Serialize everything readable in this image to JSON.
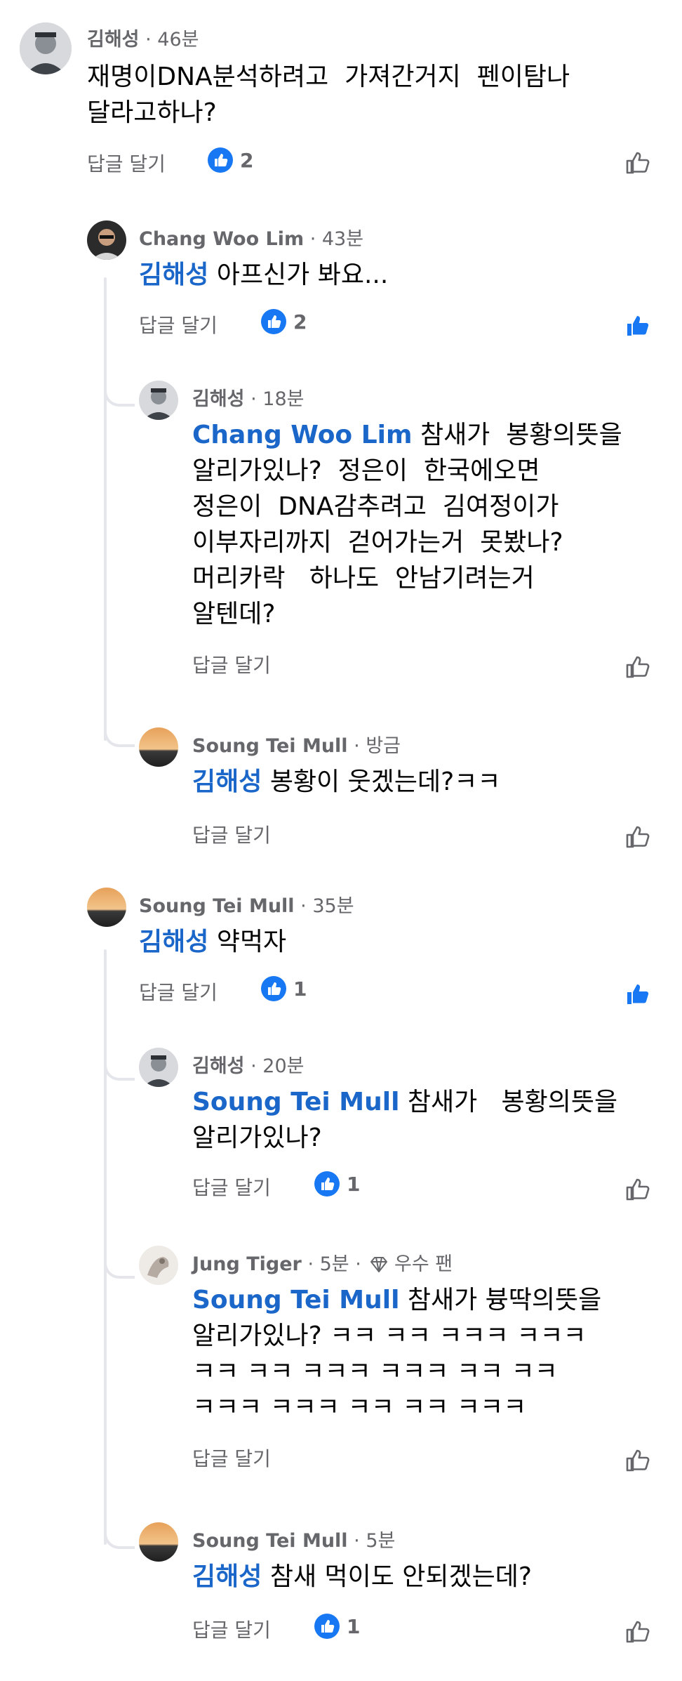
{
  "comments": [
    {
      "author": "김해성",
      "time": "· 46분",
      "text": "재명이DNA분석하려고  가져간거지  펜이탐나\n달라고하나?",
      "reply": "답글 달기",
      "likes": "2"
    },
    {
      "author": "Chang Woo Lim",
      "time": "· 43분",
      "mention": "김해성",
      "text": " 아프신가 봐요...",
      "reply": "답글 달기",
      "likes": "2"
    },
    {
      "author": "김해성",
      "time": "· 18분",
      "mention": "Chang Woo Lim",
      "text": " 참새가  봉황의뜻을\n알리가있나?  정은이  한국에오면\n정은이  DNA감추려고  김여정이가\n이부자리까지  걷어가는거  못봤나?\n머리카락   하나도  안남기려는거\n알텐데?",
      "reply": "답글 달기"
    },
    {
      "author": "Soung Tei Mull",
      "time": "· 방금",
      "mention": "김해성",
      "text": " 봉황이 웃겠는데?ㅋㅋ",
      "reply": "답글 달기"
    },
    {
      "author": "Soung Tei Mull",
      "time": "· 35분",
      "mention": "김해성",
      "text": " 약먹자",
      "reply": "답글 달기",
      "likes": "1"
    },
    {
      "author": "김해성",
      "time": "· 20분",
      "mention": "Soung Tei Mull",
      "text": " 참새가   봉황의뜻을\n알리가있나?",
      "reply": "답글 달기",
      "likes": "1"
    },
    {
      "author": "Jung Tiger",
      "time": "· 5분 ·",
      "badge": "우수 팬",
      "mention": "Soung Tei Mull",
      "text": " 참새가 븅딱의뜻을\n알리가있나? ㅋㅋ ㅋㅋ ㅋㅋㅋ ㅋㅋㅋ\nㅋㅋ ㅋㅋ ㅋㅋㅋ ㅋㅋㅋ ㅋㅋ ㅋㅋ\nㅋㅋㅋ ㅋㅋㅋ ㅋㅋ ㅋㅋ ㅋㅋㅋ",
      "reply": "답글 달기"
    },
    {
      "author": "Soung Tei Mull",
      "time": "· 5분",
      "mention": "김해성",
      "text": " 참새 먹이도 안되겠는데?",
      "reply": "답글 달기",
      "likes": "1"
    }
  ],
  "colors": {
    "accent": "#1877f2",
    "mention": "#1b66c9",
    "muted": "#65676b",
    "thread_line": "#e4e6eb"
  },
  "icons": {
    "like_badge": "thumbs-up-badge-icon",
    "like_button": "thumbs-up-outline-icon",
    "like_button_active": "thumbs-up-filled-icon",
    "badge": "diamond-icon"
  }
}
